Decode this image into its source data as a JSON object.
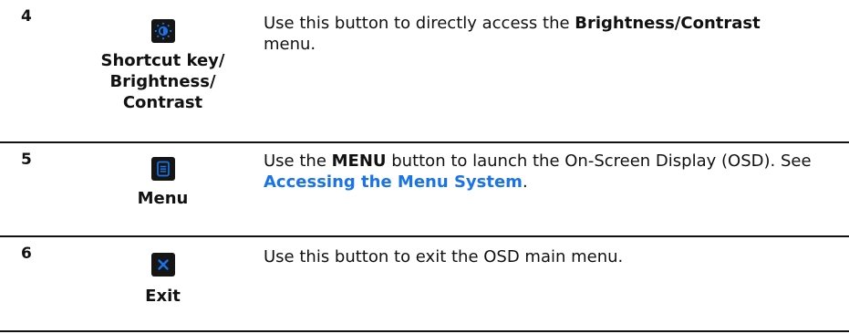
{
  "rows": [
    {
      "number": "4",
      "icon": "brightness-icon",
      "label": "Shortcut key/\nBrightness/\nContrast",
      "desc_before": "Use this button to directly access the ",
      "desc_bold": "Brightness/Contrast",
      "desc_after": "menu."
    },
    {
      "number": "5",
      "icon": "menu-icon",
      "label": "Menu",
      "desc_before": "Use the ",
      "desc_bold": "MENU",
      "desc_middle": " button to launch the On-Screen Display (OSD). See ",
      "desc_link": "Accessing the Menu System",
      "desc_after": "."
    },
    {
      "number": "6",
      "icon": "exit-icon",
      "label": "Exit",
      "desc": "Use this button to exit the OSD main menu."
    }
  ],
  "colors": {
    "icon_tile": "#151515",
    "icon_accent": "#1a73e8",
    "link": "#1a73e8",
    "divider": "#111111"
  }
}
